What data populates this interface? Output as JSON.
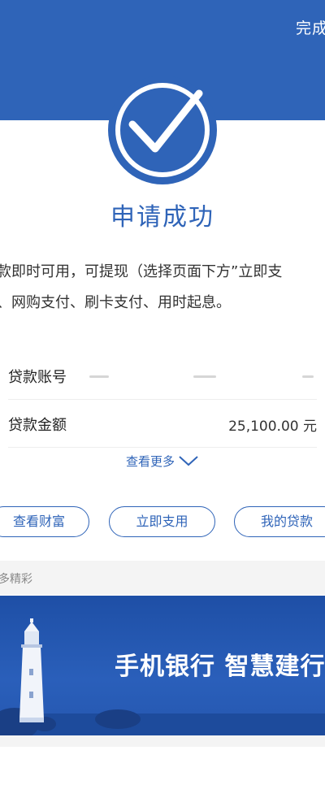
{
  "header": {
    "done_label": "完成"
  },
  "status": {
    "title": "申请成功"
  },
  "description": {
    "line1": "款即时可用，可提现（选择页面下方”立即支",
    "line2": "、网购支付、刷卡支付、用时起息。"
  },
  "details": {
    "rows": [
      {
        "label": "贷款账号",
        "value": ""
      },
      {
        "label": "贷款金额",
        "value": "25,100.00 元"
      }
    ],
    "see_more_label": "查看更多"
  },
  "actions": {
    "wealth_label": "查看财富",
    "use_label": "立即支用",
    "loan_label": "我的贷款"
  },
  "more": {
    "title": "多精彩",
    "banner_text": "手机银行  智慧建行"
  },
  "colors": {
    "brand_blue": "#2f64b8",
    "banner_blue": "#2557b0"
  },
  "icons": [
    "check-circle-icon",
    "chevron-down-icon",
    "lighthouse-illustration"
  ]
}
